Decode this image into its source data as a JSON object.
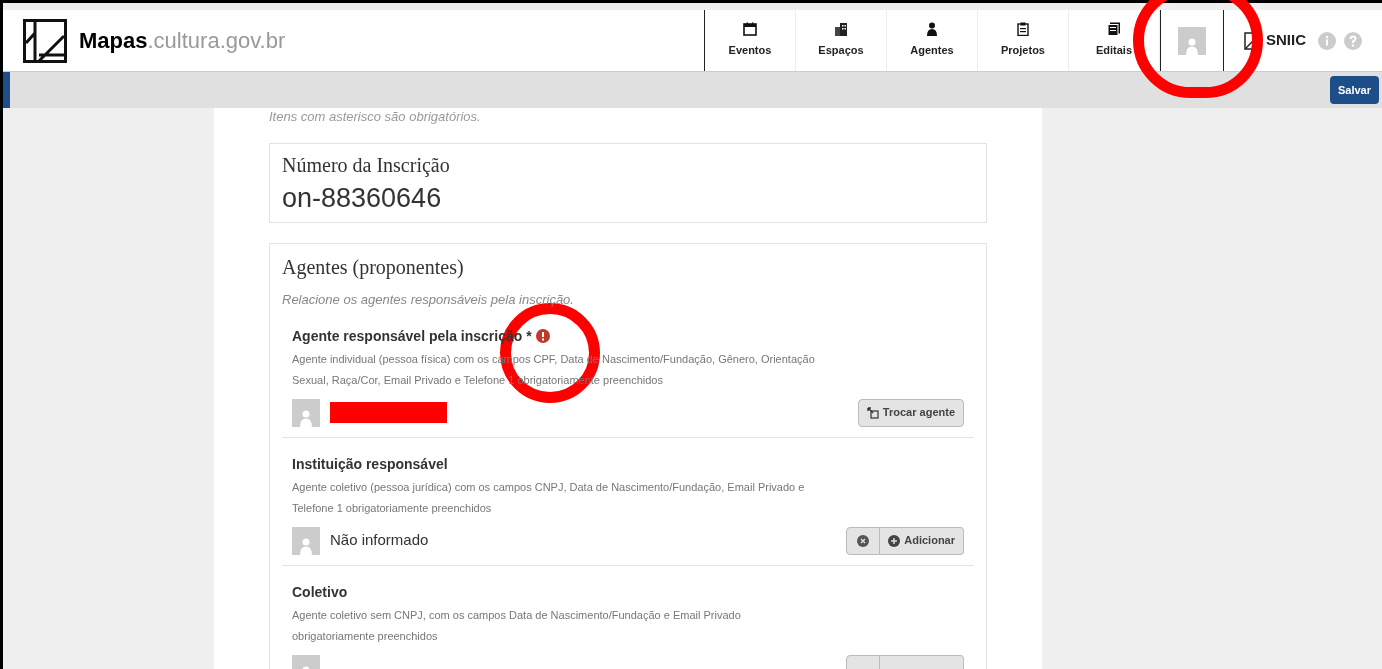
{
  "header": {
    "brand_bold": "Mapas",
    "brand_rest": ".cultura.gov.br",
    "nav": [
      {
        "label": "Eventos"
      },
      {
        "label": "Espaços"
      },
      {
        "label": "Agentes"
      },
      {
        "label": "Projetos"
      },
      {
        "label": "Editais"
      }
    ],
    "sniic": "SNIIC"
  },
  "toolbar": {
    "save": "Salvar"
  },
  "form": {
    "note": "Itens com asterisco são obrigatórios.",
    "registration": {
      "title": "Número da Inscrição",
      "number": "on-88360646"
    },
    "agents": {
      "title": "Agentes (proponentes)",
      "subtitle": "Relacione os agentes responsáveis pela inscrição.",
      "items": [
        {
          "title": "Agente responsável pela inscrição *",
          "required_error": true,
          "description": "Agente individual (pessoa física) com os campos CPF, Data de Nascimento/Fundação, Gênero, Orientação Sexual, Raça/Cor, Email Privado e Telefone 1 obrigatoriamente preenchidos",
          "kind": "filled",
          "redacted": true,
          "button": "Trocar agente"
        },
        {
          "title": "Instituição responsável",
          "required_error": false,
          "description": "Agente coletivo (pessoa jurídica) com os campos CNPJ, Data de Nascimento/Fundação, Email Privado e Telefone 1 obrigatoriamente preenchidos",
          "kind": "empty",
          "name": "Não informado",
          "button": "Adicionar"
        },
        {
          "title": "Coletivo",
          "required_error": false,
          "description": "Agente coletivo sem CNPJ, com os campos Data de Nascimento/Fundação e Email Privado obrigatoriamente preenchidos",
          "kind": "partial"
        }
      ]
    }
  }
}
